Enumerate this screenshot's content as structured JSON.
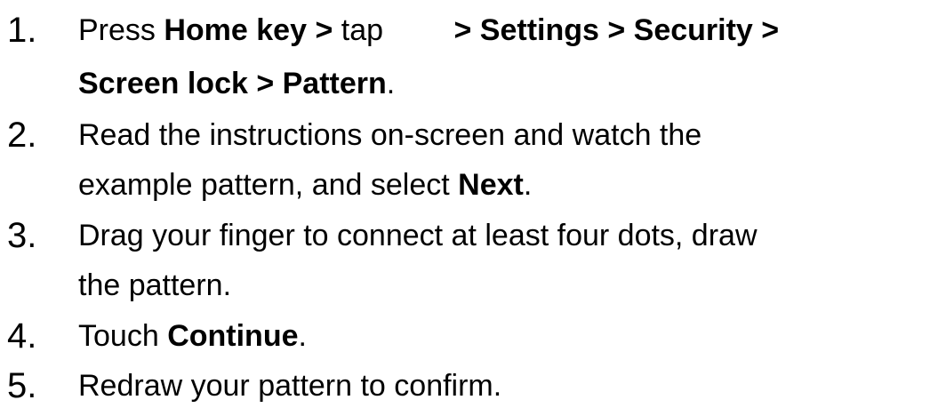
{
  "steps": [
    {
      "number": "1.",
      "line1": {
        "t1": "Press ",
        "b1": "Home key >",
        "t2": " tap ",
        "b2": "> Settings > Security >"
      },
      "line2": {
        "b1": "Screen lock > Pattern",
        "t1": "."
      }
    },
    {
      "number": "2.",
      "line1": {
        "t1": "Read the instructions on-screen and watch the"
      },
      "line2": {
        "t1": "example pattern, and select ",
        "b1": "Next",
        "t2": "."
      }
    },
    {
      "number": "3.",
      "line1": {
        "t1": "Drag your finger to connect at least four dots, draw"
      },
      "line2": {
        "t1": "the pattern."
      }
    },
    {
      "number": "4.",
      "line1": {
        "t1": "Touch ",
        "b1": "Continue",
        "t2": "."
      }
    },
    {
      "number": "5.",
      "line1": {
        "t1": "Redraw your pattern to confirm."
      }
    }
  ]
}
